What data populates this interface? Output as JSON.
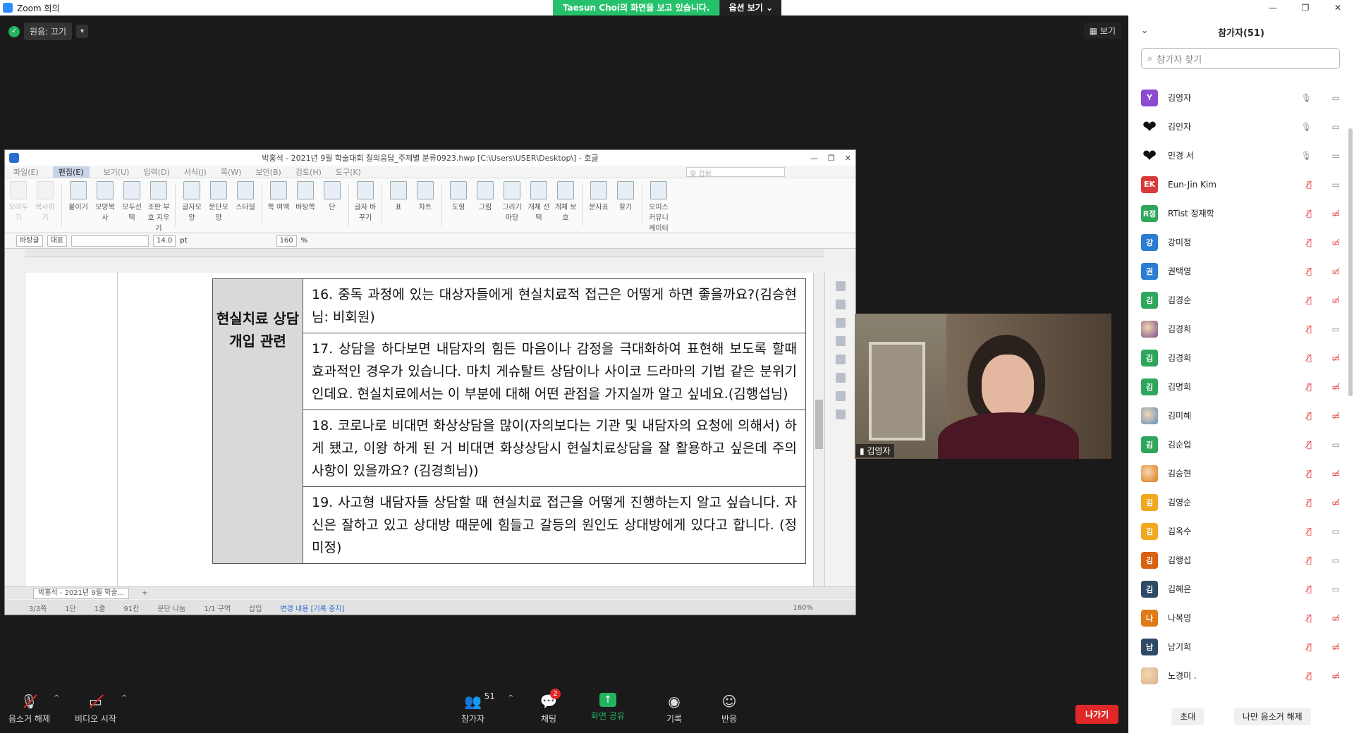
{
  "window": {
    "title": "Zoom 회의",
    "controls": [
      "—",
      "❐",
      "✕"
    ]
  },
  "share_banner": {
    "message": "Taesun  Choi의 화면을 보고 있습니다.",
    "options": "옵션 보기 ⌄"
  },
  "meeting": {
    "audio_label": "원음: 끄기",
    "view_label": "보기"
  },
  "hwp": {
    "title": "박홍석 - 2021년 9월 학술대회 질의응답_주제별 분류0923.hwp [C:\\Users\\USER\\Desktop\\] - 호글",
    "menu": [
      "파일(E)",
      "편집(E)",
      "보기(U)",
      "입력(D)",
      "서식(J)",
      "쪽(W)",
      "보안(B)",
      "검토(H)",
      "도구(K)"
    ],
    "find_placeholder": "찾 겁퇴",
    "ribbon": [
      {
        "label": "오려두기",
        "dim": true
      },
      {
        "label": "복사하기",
        "dim": true
      },
      {
        "label": "붙이기",
        "dim": false
      },
      {
        "label": "모양복사",
        "dim": false
      },
      {
        "label": "모두선택",
        "dim": false
      },
      {
        "label": "조판 부호 지우기",
        "dim": false
      },
      {
        "label": "글자모양",
        "dim": false
      },
      {
        "label": "문단모양",
        "dim": false
      },
      {
        "label": "스타일",
        "dim": false
      },
      {
        "label": "쪽 여백",
        "dim": false
      },
      {
        "label": "바탕쪽",
        "dim": false
      },
      {
        "label": "단",
        "dim": false
      },
      {
        "label": "글자 바꾸기",
        "dim": false
      },
      {
        "label": "표",
        "dim": false
      },
      {
        "label": "차트",
        "dim": false
      },
      {
        "label": "도형",
        "dim": false
      },
      {
        "label": "그림",
        "dim": false
      },
      {
        "label": "그리기마당",
        "dim": false
      },
      {
        "label": "개체 선택",
        "dim": false
      },
      {
        "label": "개체 보호",
        "dim": false
      },
      {
        "label": "문자표",
        "dim": false
      },
      {
        "label": "찾기",
        "dim": false
      },
      {
        "label": "오피스 커뮤니케이터",
        "dim": false
      }
    ],
    "format": {
      "style": "바탕글",
      "lang": "대표",
      "font": "",
      "size": "14.0",
      "unit": "pt",
      "zoom": "160",
      "zoom_unit": "%"
    },
    "category": "현실치료 상담 개입 관련",
    "questions": [
      "16. 중독 과정에 있는 대상자들에게 현실치료적 접근은 어떻게 하면 좋을까요?(김승현님: 비회원)",
      "17. 상담을 하다보면 내담자의 힘든 마음이나 감정을 극대화하여 표현해 보도록 할때 효과적인 경우가 있습니다. 마치 게슈탈트 상담이나 사이코 드라마의 기법 같은 분위기인데요. 현실치료에서는 이 부분에 대해 어떤 관점을 가지실까 알고 싶네요.(김행섭님)",
      "18.  코로나로 비대면 화상상담을 많이(자의보다는 기관 및 내담자의 요청에 의해서) 하게 됐고, 이왕 하게 된 거 비대면 화상상담시 현실치료상담을 잘 활용하고 싶은데 주의사항이 있을까요? (김경희님))",
      "19. 사고형 내담자들 상담할 때 현실치료 접근을 어떻게 진행하는지 알고 싶습니다. 자신은 잘하고 있고 상대방 때문에 힘들고 갈등의 원인도 상대방에게 있다고 합니다. (정미정)"
    ],
    "tab_label": "박홍석 - 2021년 9월 학술...",
    "status": {
      "page": "3/3쪽",
      "column": "1단",
      "line": "1줄",
      "col": "91칸",
      "section_break": "문단 나눔",
      "area": "1/1 구역",
      "mode": "삽입",
      "track": "변경 내용 [기록 중지]",
      "zoom": "160%"
    }
  },
  "video": {
    "name": "김영자"
  },
  "toolbar": {
    "unmute": "음소거 해제",
    "start_video": "비디오 시작",
    "participants": "참가자",
    "participants_count": "51",
    "chat": "채팅",
    "chat_badge": "2",
    "share": "화면 공유",
    "record": "기록",
    "reactions": "반응",
    "leave": "나가기"
  },
  "panel": {
    "title": "참가자(51)",
    "search_placeholder": "참가자 찾기",
    "participants": [
      {
        "initial": "Y",
        "name": "김영자",
        "color": "#8b4bd1",
        "type": "text",
        "mic": "on",
        "cam": "on"
      },
      {
        "initial": "",
        "name": "김인자",
        "color": "#ffffff",
        "type": "heart",
        "mic": "on",
        "cam": "on"
      },
      {
        "initial": "",
        "name": "민경 서",
        "color": "#ffffff",
        "type": "heart",
        "mic": "on",
        "cam": "on"
      },
      {
        "initial": "EK",
        "name": "Eun-Jin Kim",
        "color": "#d83a3a",
        "type": "text",
        "mic": "off",
        "cam": "on"
      },
      {
        "initial": "R정",
        "name": "RTist 정재학",
        "color": "#2ea65b",
        "type": "text",
        "mic": "off",
        "cam": "off"
      },
      {
        "initial": "강",
        "name": "강미정",
        "color": "#2a7dd1",
        "type": "text",
        "mic": "off",
        "cam": "off"
      },
      {
        "initial": "권",
        "name": "권택영",
        "color": "#2a7dd1",
        "type": "text",
        "mic": "off",
        "cam": "off"
      },
      {
        "initial": "김",
        "name": "김경순",
        "color": "#2ea65b",
        "type": "text",
        "mic": "off",
        "cam": "off"
      },
      {
        "initial": "",
        "name": "김경희",
        "color": "#7a4f8a",
        "type": "img",
        "mic": "off",
        "cam": "on"
      },
      {
        "initial": "김",
        "name": "김경희",
        "color": "#2ea65b",
        "type": "text",
        "mic": "off",
        "cam": "off"
      },
      {
        "initial": "김",
        "name": "김명희",
        "color": "#2ea65b",
        "type": "text",
        "mic": "off",
        "cam": "off"
      },
      {
        "initial": "",
        "name": "김미혜",
        "color": "#5e8fc2",
        "type": "img",
        "mic": "off",
        "cam": "off"
      },
      {
        "initial": "김",
        "name": "김순업",
        "color": "#2ea65b",
        "type": "text",
        "mic": "off",
        "cam": "on"
      },
      {
        "initial": "",
        "name": "김승현",
        "color": "#e07a16",
        "type": "img",
        "mic": "off",
        "cam": "off"
      },
      {
        "initial": "김",
        "name": "김영순",
        "color": "#f0a81f",
        "type": "text",
        "mic": "off",
        "cam": "off"
      },
      {
        "initial": "김",
        "name": "김옥수",
        "color": "#f0a81f",
        "type": "text",
        "mic": "off",
        "cam": "on"
      },
      {
        "initial": "김",
        "name": "김행섭",
        "color": "#d9600f",
        "type": "text",
        "mic": "off",
        "cam": "on"
      },
      {
        "initial": "김",
        "name": "김혜은",
        "color": "#2f4a66",
        "type": "text",
        "mic": "off",
        "cam": "on"
      },
      {
        "initial": "나",
        "name": "나복영",
        "color": "#e07a16",
        "type": "text",
        "mic": "off",
        "cam": "off"
      },
      {
        "initial": "남",
        "name": "남기희",
        "color": "#2f4a66",
        "type": "text",
        "mic": "off",
        "cam": "off"
      },
      {
        "initial": "",
        "name": "노경미 .",
        "color": "#d9b08c",
        "type": "img",
        "mic": "off",
        "cam": "off"
      }
    ],
    "invite": "초대",
    "unmute_me": "나만 음소거 해제"
  }
}
